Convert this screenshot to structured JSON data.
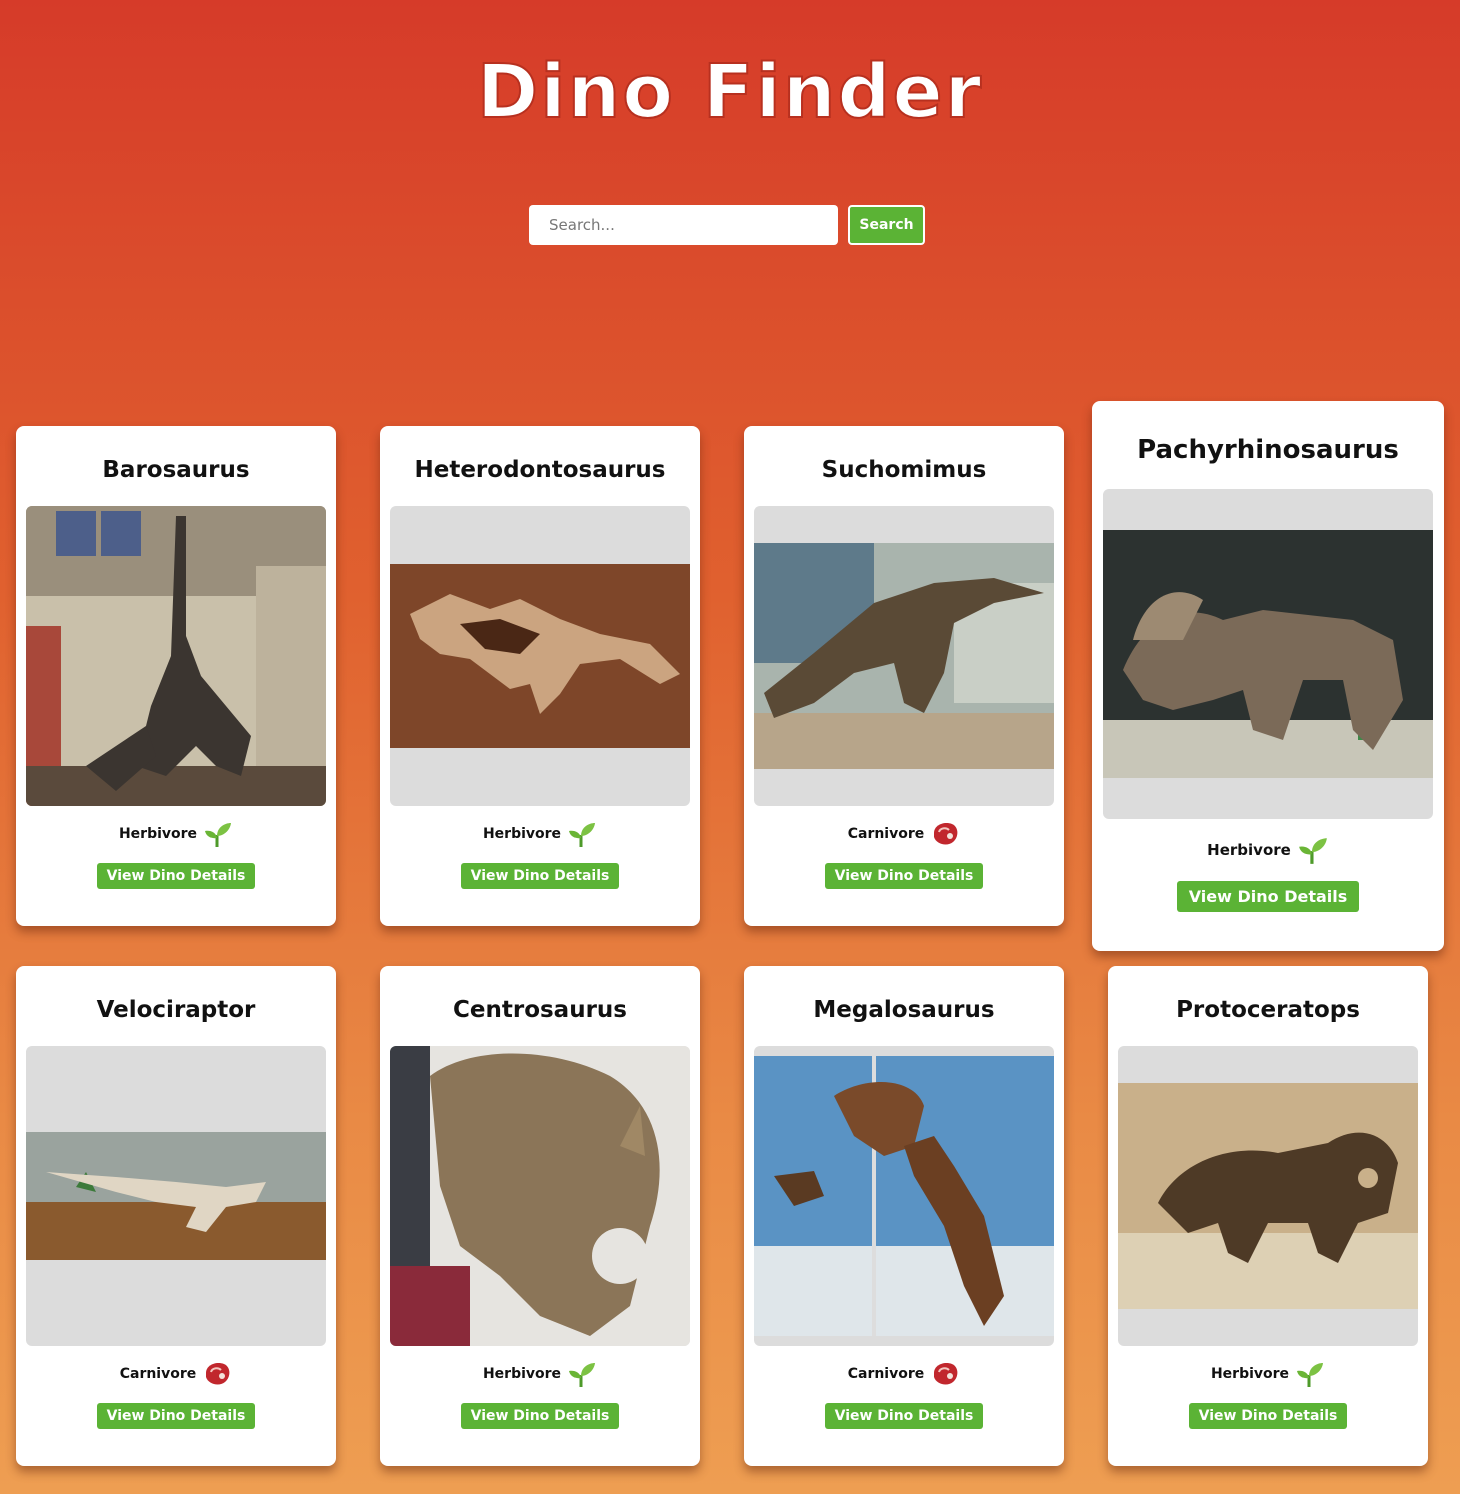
{
  "header": {
    "title": "Dino Finder"
  },
  "search": {
    "placeholder": "Search...",
    "button_label": "Search"
  },
  "cards": [
    {
      "name": "Barosaurus",
      "diet": "Herbivore",
      "diet_icon": "sprout-icon",
      "button": "View Dino Details"
    },
    {
      "name": "Heterodontosaurus",
      "diet": "Herbivore",
      "diet_icon": "sprout-icon",
      "button": "View Dino Details"
    },
    {
      "name": "Suchomimus",
      "diet": "Carnivore",
      "diet_icon": "meat-icon",
      "button": "View Dino Details"
    },
    {
      "name": "Pachyrhinosaurus",
      "diet": "Herbivore",
      "diet_icon": "sprout-icon",
      "button": "View Dino Details"
    },
    {
      "name": "Velociraptor",
      "diet": "Carnivore",
      "diet_icon": "meat-icon",
      "button": "View Dino Details"
    },
    {
      "name": "Centrosaurus",
      "diet": "Herbivore",
      "diet_icon": "sprout-icon",
      "button": "View Dino Details"
    },
    {
      "name": "Megalosaurus",
      "diet": "Carnivore",
      "diet_icon": "meat-icon",
      "button": "View Dino Details"
    },
    {
      "name": "Protoceratops",
      "diet": "Herbivore",
      "diet_icon": "sprout-icon",
      "button": "View Dino Details"
    }
  ],
  "colors": {
    "accent_green": "#5bb335",
    "bg_top": "#d63b29",
    "bg_bottom": "#ee9e52"
  }
}
